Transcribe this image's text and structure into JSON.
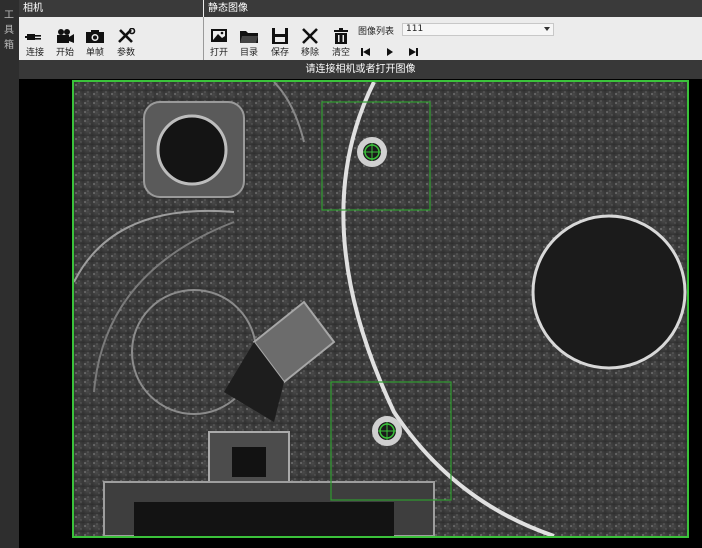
{
  "toolbox": {
    "label": "工具箱",
    "chars": [
      "工",
      "具",
      "箱"
    ]
  },
  "groups": {
    "camera": "相机",
    "static_image": "静态图像"
  },
  "camera_tools": [
    {
      "label": "连接",
      "icon": "plug-icon"
    },
    {
      "label": "开始",
      "icon": "video-camera-icon"
    },
    {
      "label": "单帧",
      "icon": "photo-camera-icon"
    },
    {
      "label": "参数",
      "icon": "tools-icon"
    }
  ],
  "image_tools": [
    {
      "label": "打开",
      "icon": "open-image-icon"
    },
    {
      "label": "目录",
      "icon": "folder-icon"
    },
    {
      "label": "保存",
      "icon": "save-icon"
    },
    {
      "label": "移除",
      "icon": "remove-x-icon"
    },
    {
      "label": "清空",
      "icon": "trash-icon"
    }
  ],
  "image_list": {
    "label": "图像列表",
    "selected": "111"
  },
  "status": {
    "message": "请连接相机或者打开图像"
  },
  "colors": {
    "ribbon_bg": "#ececec",
    "header_bg": "#3a3a3a",
    "status_bg": "#383838",
    "roi_green": "#3bc23b"
  }
}
